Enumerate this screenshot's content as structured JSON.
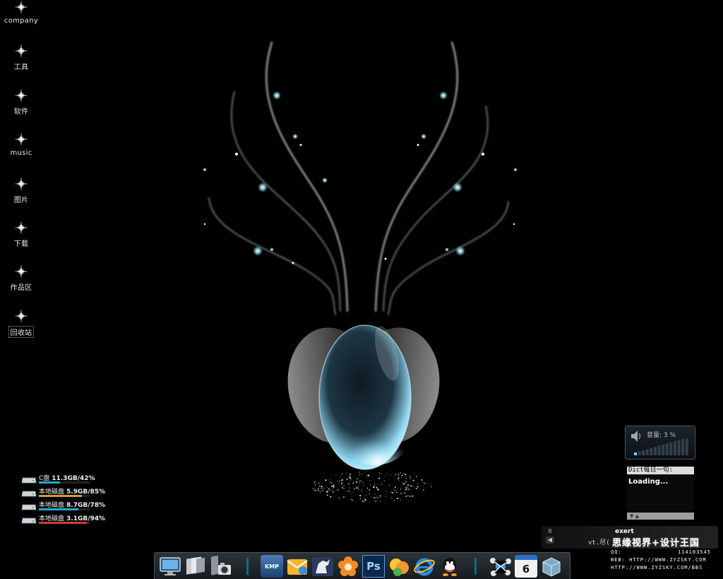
{
  "desktop_icons": [
    {
      "label": "company"
    },
    {
      "label": "工具"
    },
    {
      "label": "软件"
    },
    {
      "label": "music"
    },
    {
      "label": "图片"
    },
    {
      "label": "下载"
    },
    {
      "label": "作品区"
    },
    {
      "label": "回收站"
    }
  ],
  "drives": [
    {
      "name": "C盘",
      "info": "11.3GB/42%",
      "percent": 42,
      "color": "#29a9c9"
    },
    {
      "name": "本地磁盘",
      "info": "5.9GB/85%",
      "percent": 85,
      "color": "#d49a3a"
    },
    {
      "name": "本地磁盘",
      "info": "8.7GB/78%",
      "percent": 78,
      "color": "#29a9c9"
    },
    {
      "name": "本地磁盘",
      "info": "3.1GB/94%",
      "percent": 94,
      "color": "#d23a3a"
    }
  ],
  "volume": {
    "label": "音量: 3 %",
    "level_percent": 3
  },
  "dict": {
    "header": "Dict每日一句:",
    "body": "Loading...",
    "footer": "▼ ▲"
  },
  "player": {
    "title": "exert",
    "word": "vt.尽(",
    "pause_icon": "pause-icon",
    "volume_icon": "speaker-icon"
  },
  "watermark": {
    "title": "思缘视界+设计王国",
    "qq_label": "QQ:",
    "qq_number": "114103545",
    "web1": "WEB: HTTP://WWW.ZYZSKY.COM",
    "web2": "HTTP://WWW.ZYZSKY.COM/BBS"
  },
  "dock": {
    "icons": [
      "monitor-icon",
      "folders-icon",
      "camera-icon",
      "kmplayer-icon",
      "outlook-icon",
      "horse-app-icon",
      "flower-app-icon",
      "photoshop-icon",
      "msn-icon",
      "ie-icon",
      "qq-icon",
      "network-icon",
      "calendar-icon",
      "system-icon"
    ],
    "ps_label": "Ps",
    "kmp_label": "KMP",
    "calendar_day": "6"
  },
  "colors": {
    "background": "#000000",
    "glow": "#7fe3ff",
    "dock_accent": "#0a6a8a"
  }
}
